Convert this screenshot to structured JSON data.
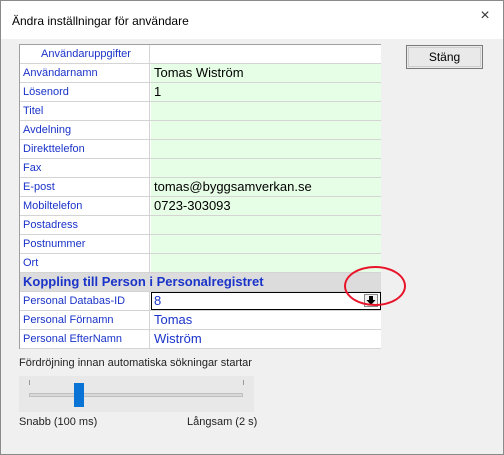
{
  "window": {
    "title": "Ändra inställningar för användare",
    "close_glyph": "×"
  },
  "grid": {
    "header": "Användaruppgifter",
    "fields": [
      {
        "label": "Användarnamn",
        "value": "Tomas Wiström"
      },
      {
        "label": "Lösenord",
        "value": "1"
      },
      {
        "label": "Titel",
        "value": ""
      },
      {
        "label": "Avdelning",
        "value": ""
      },
      {
        "label": "Direkttelefon",
        "value": ""
      },
      {
        "label": "Fax",
        "value": ""
      },
      {
        "label": "E-post",
        "value": "tomas@byggsamverkan.se"
      },
      {
        "label": "Mobiltelefon",
        "value": "0723-303093"
      },
      {
        "label": "Postadress",
        "value": ""
      },
      {
        "label": "Postnummer",
        "value": ""
      },
      {
        "label": "Ort",
        "value": ""
      }
    ],
    "section": "Koppling till Person i Personalregistret",
    "person_fields": [
      {
        "label": "Personal Databas-ID",
        "value": "8"
      },
      {
        "label": "Personal Förnamn",
        "value": "Tomas"
      },
      {
        "label": "Personal EfterNamn",
        "value": "Wiström"
      }
    ]
  },
  "buttons": {
    "close_label": "Stäng"
  },
  "slider": {
    "label": "Fördröjning innan automatiska sökningar startar",
    "min_label": "Snabb (100 ms)",
    "max_label": "Långsam (2 s)",
    "position_fraction": 0.22
  },
  "colors": {
    "label_blue": "#1a33c9",
    "field_green": "#e6fde6",
    "slider_thumb": "#0a74d6",
    "annotation_red": "#e8152a"
  }
}
